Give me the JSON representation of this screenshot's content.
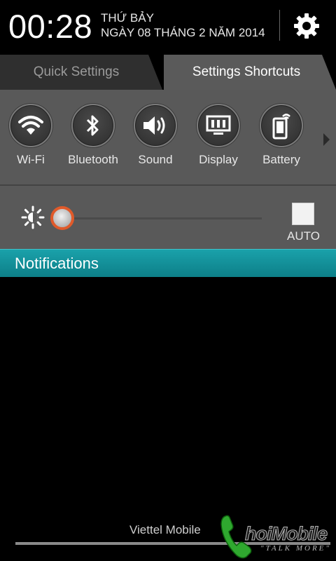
{
  "status_header": {
    "time": "00:28",
    "day": "THỨ BẢY",
    "date": "NGÀY 08 THÁNG 2 NĂM 2014",
    "settings_icon": "gear-icon"
  },
  "tabs": [
    {
      "label": "Quick Settings",
      "active": false
    },
    {
      "label": "Settings Shortcuts",
      "active": true
    }
  ],
  "shortcuts": [
    {
      "label": "Wi-Fi",
      "icon": "wifi-icon"
    },
    {
      "label": "Bluetooth",
      "icon": "bluetooth-icon"
    },
    {
      "label": "Sound",
      "icon": "speaker-icon"
    },
    {
      "label": "Display",
      "icon": "display-icon"
    },
    {
      "label": "Battery",
      "icon": "battery-icon"
    }
  ],
  "brightness": {
    "level_fraction": 0.0,
    "auto_label": "AUTO",
    "auto_checked": false
  },
  "notifications": {
    "header": "Notifications"
  },
  "carrier": "Viettel Mobile",
  "watermark": {
    "brand": "hoiMobile",
    "tagline": "\"TALK MORE\""
  },
  "colors": {
    "accent_teal": "#1aa1aa",
    "slider_thumb_ring": "#e05a2a",
    "panel_gray": "#595959"
  }
}
